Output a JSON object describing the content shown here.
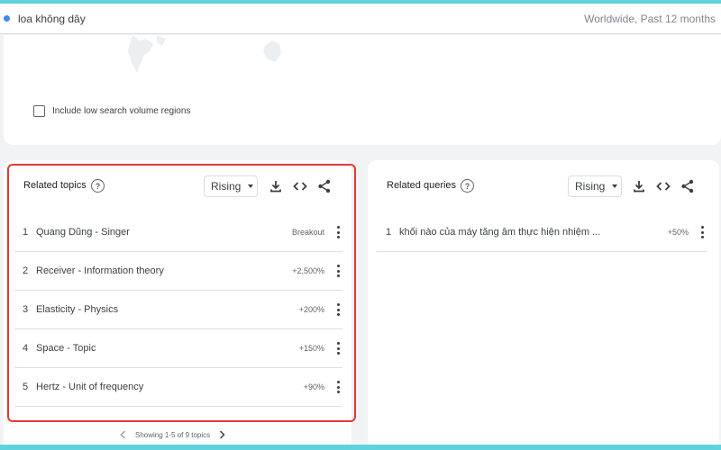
{
  "search_bar": {
    "term": "loa không dây",
    "meta": "Worldwide, Past 12 months",
    "color": "#4285f4"
  },
  "map_card": {
    "low_volume_label": "Include low search volume regions"
  },
  "related_topics": {
    "title": "Related topics",
    "help_icon": "?",
    "sort_label": "Rising",
    "rows": [
      {
        "rank": "1",
        "label": "Quang Dũng - Singer",
        "value": "Breakout"
      },
      {
        "rank": "2",
        "label": "Receiver - Information theory",
        "value": "+2,500%"
      },
      {
        "rank": "3",
        "label": "Elasticity - Physics",
        "value": "+200%"
      },
      {
        "rank": "4",
        "label": "Space - Topic",
        "value": "+150%"
      },
      {
        "rank": "5",
        "label": "Hertz - Unit of frequency",
        "value": "+90%"
      }
    ],
    "pagination": "Showing 1-5 of 9 topics"
  },
  "related_queries": {
    "title": "Related queries",
    "help_icon": "?",
    "sort_label": "Rising",
    "rows": [
      {
        "rank": "1",
        "label": "khối nào của máy tăng âm thực hiện nhiệm ...",
        "value": "+50%"
      }
    ]
  },
  "icons": [
    "download-icon",
    "embed-code-icon",
    "share-icon",
    "help-icon",
    "more-vert-icon",
    "chevron-left-icon",
    "chevron-right-icon"
  ],
  "colors": {
    "highlight": "#e53935",
    "frame": "#5ed3de"
  }
}
